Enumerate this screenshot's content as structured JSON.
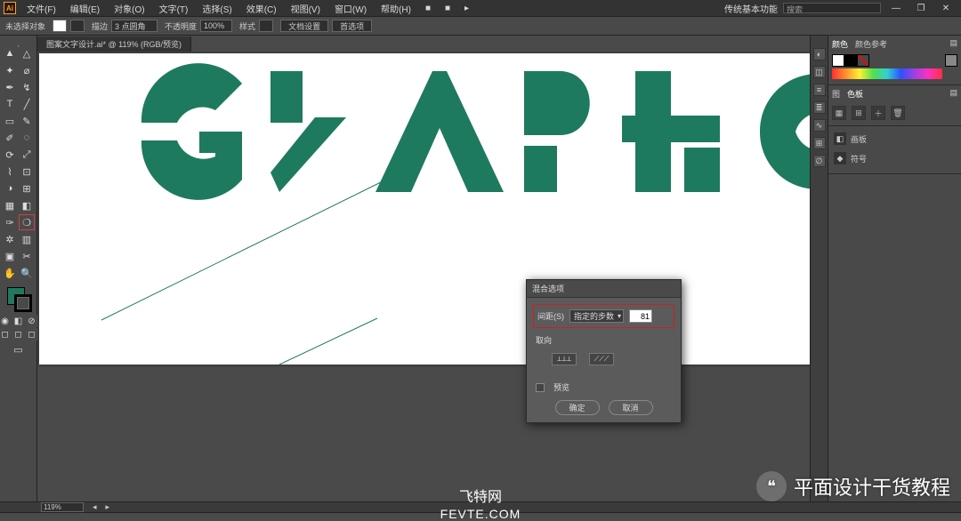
{
  "app_badge": "Ai",
  "menu": {
    "items": [
      "文件(F)",
      "编辑(E)",
      "对象(O)",
      "文字(T)",
      "选择(S)",
      "效果(C)",
      "视图(V)",
      "窗口(W)",
      "帮助(H)"
    ],
    "br_quick": [
      "■",
      "■",
      "▸"
    ],
    "workspace_label": "传统基本功能",
    "search_placeholder": "搜索"
  },
  "controlbar": {
    "label_no_selection": "未选择对象",
    "stroke_label": "描边",
    "stroke_value": "3 点圆角",
    "opacity_label": "不透明度",
    "opacity_value": "100%",
    "style_label": "样式",
    "btn_doc_setup": "文档设置",
    "btn_prefs": "首选项"
  },
  "document_tab": "图案文字设计.ai* @ 119% (RGB/预览)",
  "statusbar": {
    "zoom": "119%"
  },
  "dialog": {
    "title": "混合选项",
    "spacing_label": "间距(S)",
    "spacing_mode": "指定的步数",
    "spacing_value": "81",
    "orientation_label": "取向",
    "preview_label": "预览",
    "ok": "确定",
    "cancel": "取消"
  },
  "right_panels": {
    "color_tab": "颜色",
    "color_guide_tab": "颜色参考",
    "lib_tabs": [
      "图",
      "色板"
    ],
    "lib_items": [
      {
        "icon": "◧",
        "label": "画板"
      },
      {
        "icon": "◆",
        "label": "符号"
      }
    ]
  },
  "collapsed_tabs": [
    "◐",
    "◫",
    "≡",
    "≣",
    "∿",
    "⊞",
    "∅"
  ],
  "overlay": {
    "site_cn": "飞特网",
    "site_en": "FEVTE.COM",
    "channel": "平面设计干货教程"
  },
  "graphic_letters": "GRAPHIC"
}
